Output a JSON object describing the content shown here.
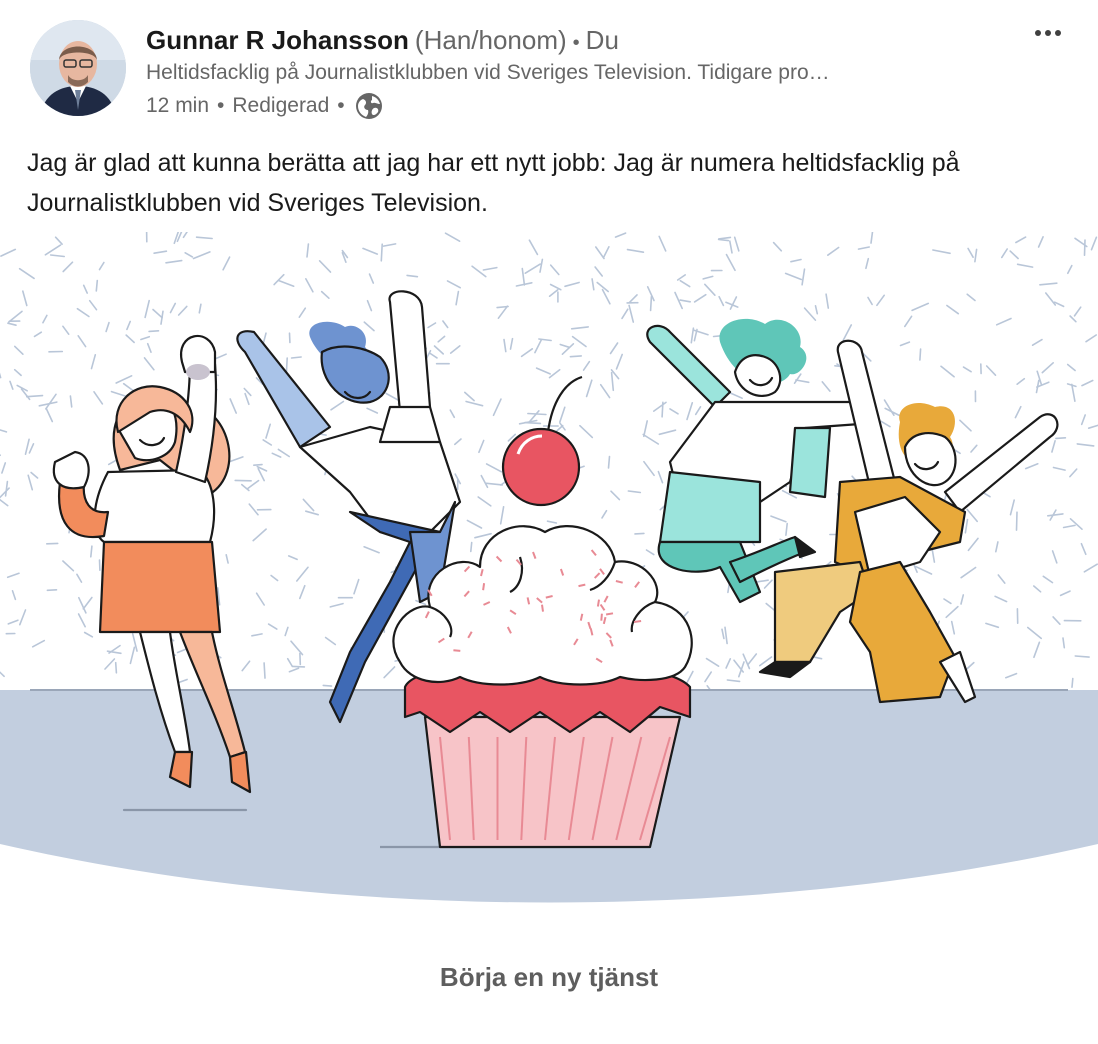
{
  "author": {
    "name": "Gunnar R Johansson",
    "pronouns": "(Han/honom)",
    "separator": "•",
    "connection_degree": "Du",
    "headline": "Heltidsfacklig på Journalistklubben vid Sveriges Television. Tidigare pro…"
  },
  "meta": {
    "time": "12 min",
    "separator": "•",
    "edited": "Redigerad",
    "separator2": "•",
    "visibility_icon": "globe-icon"
  },
  "post": {
    "text": "Jag är glad att kunna berätta att jag har ett nytt jobb: Jag är numera heltidsfacklig på Journalistklubben vid Sveriges Television."
  },
  "illustration": {
    "subject": "celebration-cupcake-illustration",
    "caption": "Börja en ny tjänst"
  },
  "colors": {
    "orange": "#f28c5c",
    "blue": "#3f6ab5",
    "light_blue": "#a9c3e8",
    "teal": "#5fc6b8",
    "yellow": "#e8a93a",
    "cherry": "#e85562",
    "floor": "#c2cedf",
    "cupcake_base": "#f7c4c8"
  }
}
